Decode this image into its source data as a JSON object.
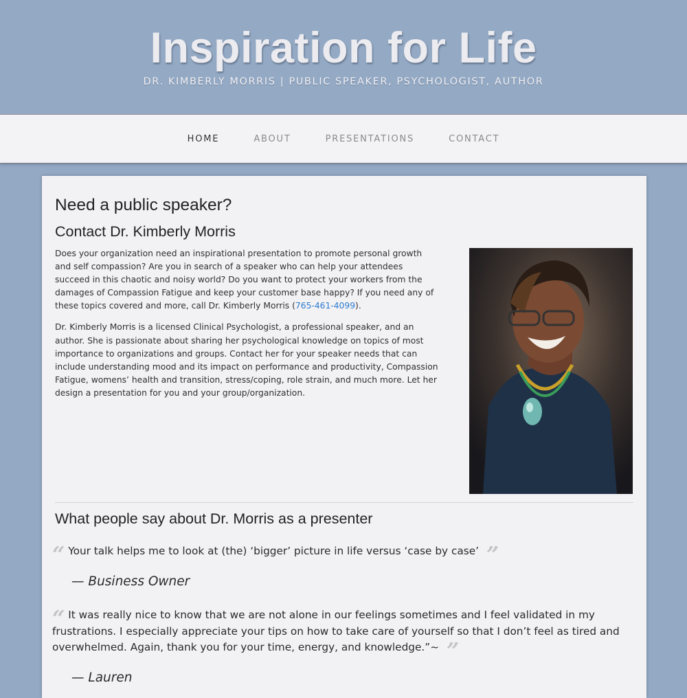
{
  "header": {
    "title": "Inspiration for Life",
    "tagline": "DR. KIMBERLY MORRIS | PUBLIC SPEAKER, PSYCHOLOGIST, AUTHOR"
  },
  "nav": {
    "items": [
      {
        "label": "HOME"
      },
      {
        "label": "ABOUT"
      },
      {
        "label": "PRESENTATIONS"
      },
      {
        "label": "CONTACT"
      }
    ]
  },
  "main": {
    "heading": "Need a public speaker?",
    "subheading": "Contact Dr. Kimberly Morris",
    "intro_before_phone": "Does your organization need an inspirational presentation to promote personal growth and self compassion? Are you in search of a speaker who can help your attendees succeed in this chaotic and noisy world? Do you want to protect your workers from the damages of Compassion Fatigue and keep your customer base happy? If you need any of these topics covered and more, call Dr. Kimberly Morris (",
    "phone": "765-461-4099",
    "intro_after_phone": ").",
    "bio": "Dr. Kimberly Morris is a licensed Clinical Psychologist, a professional speaker, and an author. She is passionate about sharing her psychological knowledge on topics of most importance to organizations and groups. Contact her for your speaker needs that can include understanding mood and its impact on performance and productivity, Compassion Fatigue, womens’ health and transition, stress/coping, role strain, and much more. Let her design a presentation for you and your group/organization."
  },
  "testimonials": {
    "heading": "What people say about Dr. Morris as a presenter",
    "items": [
      {
        "quote": "Your talk helps me to look at (the) ‘bigger’ picture in life versus ‘case by case’",
        "author": "— Business Owner"
      },
      {
        "quote": "It was really nice to know that we are not alone in our feelings sometimes and I feel validated in my frustrations. I especially appreciate your tips on how to take care of yourself so that I don’t feel as tired and overwhelmed. Again, thank you for your time, energy, and knowledge.”~",
        "author": "— Lauren"
      }
    ]
  },
  "colors": {
    "background": "#93a9c4",
    "nav_background": "#f3f2f5",
    "content_background": "#f2f1f4",
    "link": "#2a7bd0"
  }
}
